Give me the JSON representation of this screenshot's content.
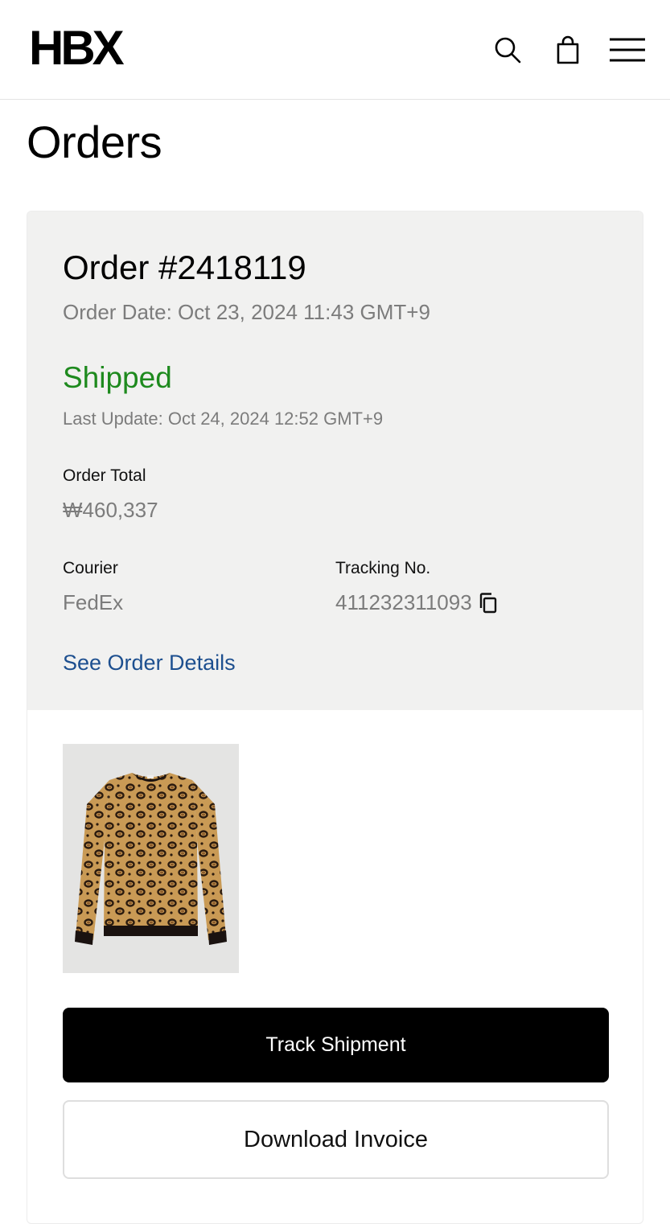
{
  "header": {
    "logo": "HBX",
    "icons": [
      "search-icon",
      "shopping-bag-icon",
      "hamburger-menu-icon"
    ]
  },
  "page": {
    "title": "Orders"
  },
  "order": {
    "number": "Order #2418119",
    "date": "Order Date: Oct 23, 2024 11:43 GMT+9",
    "status": "Shipped",
    "status_color": "#1e8a1e",
    "last_update": "Last Update: Oct 24, 2024 12:52 GMT+9",
    "total_label": "Order Total",
    "total_value": "₩460,337",
    "courier_label": "Courier",
    "courier_value": "FedEx",
    "tracking_label": "Tracking No.",
    "tracking_value": "411232311093",
    "details_link": "See Order Details",
    "product_image": "leopard-print-crewneck-sweater"
  },
  "actions": {
    "track_label": "Track Shipment",
    "invoice_label": "Download Invoice"
  },
  "colors": {
    "link": "#1d4f8f",
    "summary_bg": "#f1f1f0",
    "primary_button": "#000000"
  }
}
